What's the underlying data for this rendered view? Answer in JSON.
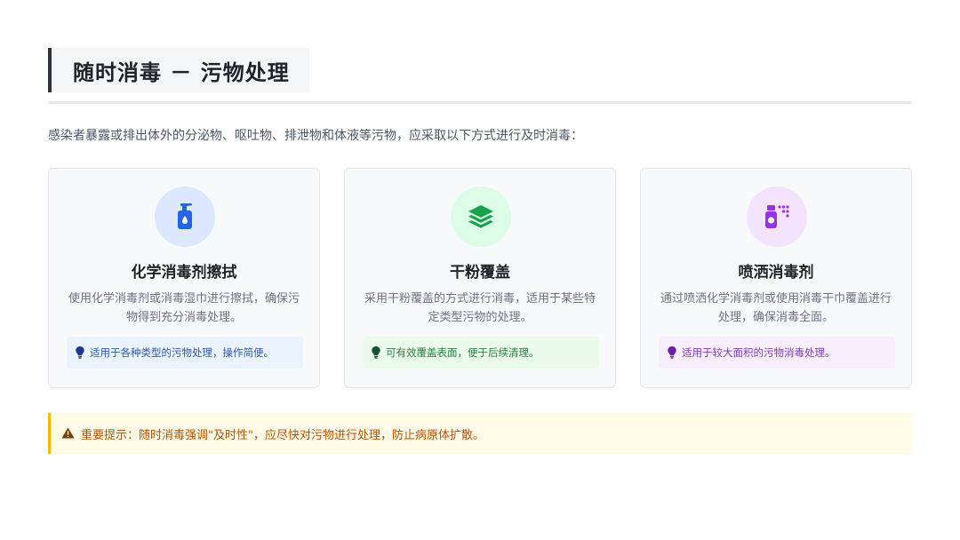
{
  "title": "随时消毒 － 污物处理",
  "intro": "感染者暴露或排出体外的分泌物、呕吐物、排泄物和体液等污物，应采取以下方式进行及时消毒：",
  "colors": {
    "blue": "#2563eb",
    "blue_bg": "#dbe8ff",
    "green": "#16a34a",
    "green_bg": "#dcfce7",
    "purple": "#9333ea",
    "purple_bg": "#f3e3ff",
    "warning": "#b45309",
    "warning_bg": "#fffbe6",
    "warning_border": "#f5b800"
  },
  "cards": [
    {
      "icon": "pump-bottle-icon",
      "title": "化学消毒剂擦拭",
      "desc": "使用化学消毒剂或消毒湿巾进行擦拭，确保污物得到充分消毒处理。",
      "tip": "适用于各种类型的污物处理，操作简便。"
    },
    {
      "icon": "layers-icon",
      "title": "干粉覆盖",
      "desc": "采用干粉覆盖的方式进行消毒，适用于某些特定类型污物的处理。",
      "tip": "可有效覆盖表面，便于后续清理。"
    },
    {
      "icon": "spray-can-icon",
      "title": "喷洒消毒剂",
      "desc": "通过喷洒化学消毒剂或使用消毒干巾覆盖进行处理，确保消毒全面。",
      "tip": "适用于较大面积的污物消毒处理。"
    }
  ],
  "notice": {
    "icon": "warning-icon",
    "text": "重要提示：随时消毒强调\"及时性\"，应尽快对污物进行处理，防止病原体扩散。"
  }
}
